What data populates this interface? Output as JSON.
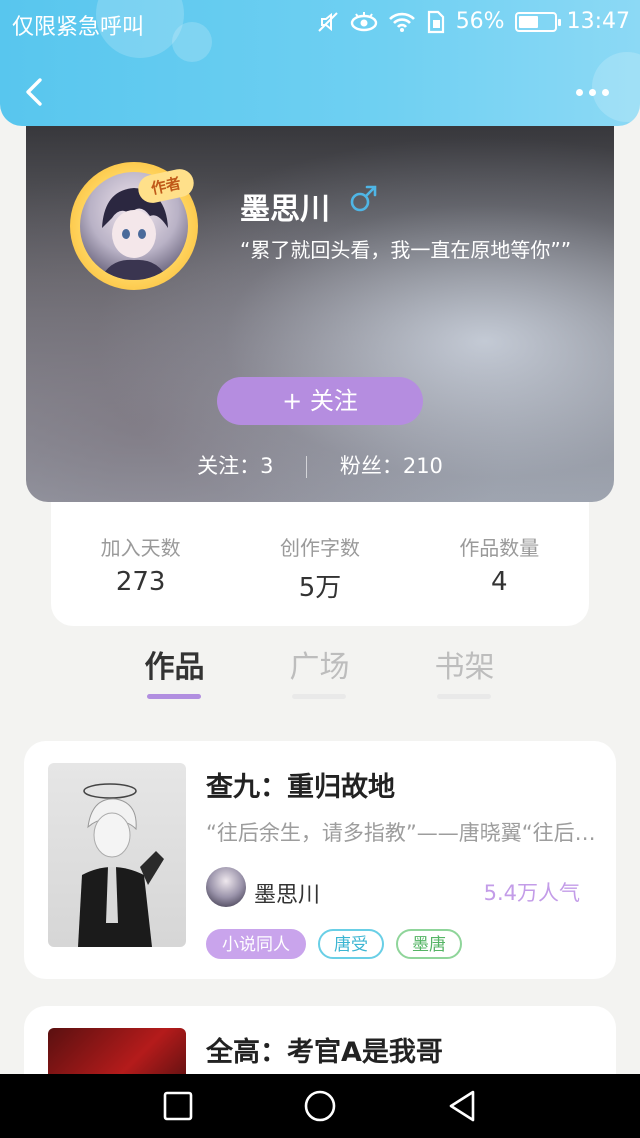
{
  "status_bar": {
    "carrier": "仅限紧急呼叫",
    "battery": "56%",
    "battery_level": 0.56,
    "time": "13:47",
    "icons": [
      "mute-icon",
      "eye-icon",
      "wifi-icon",
      "sim-icon",
      "battery-icon"
    ]
  },
  "nav": {
    "back_icon": "chevron-left-icon",
    "more_icon": "more-dots-icon"
  },
  "profile": {
    "author_tag": "作者",
    "name": "墨思川",
    "gender_icon": "male-icon",
    "motto": "“累了就回头看，我一直在原地等你””",
    "follow_button": "+  关注",
    "follow_label": "关注：3",
    "fans_label": "粉丝：210"
  },
  "stats": [
    {
      "label": "加入天数",
      "value": "273"
    },
    {
      "label": "创作字数",
      "value": "5万"
    },
    {
      "label": "作品数量",
      "value": "4"
    }
  ],
  "tabs": [
    {
      "label": "作品",
      "active": true
    },
    {
      "label": "广场",
      "active": false
    },
    {
      "label": "书架",
      "active": false
    }
  ],
  "works": [
    {
      "title": "查九：重归故地",
      "desc": "“往后余生，请多指教”——唐晓翼“往后余生，请多指教”",
      "author": "墨思川",
      "popularity": "5.4万人气",
      "tags": [
        "小说同人",
        "唐受",
        "墨唐"
      ]
    },
    {
      "title": "全高：考官A是我哥"
    }
  ],
  "colors": {
    "header_blue": "#5cc8ef",
    "accent_purple": "#b58de0",
    "popularity_purple": "#c39ce8"
  }
}
